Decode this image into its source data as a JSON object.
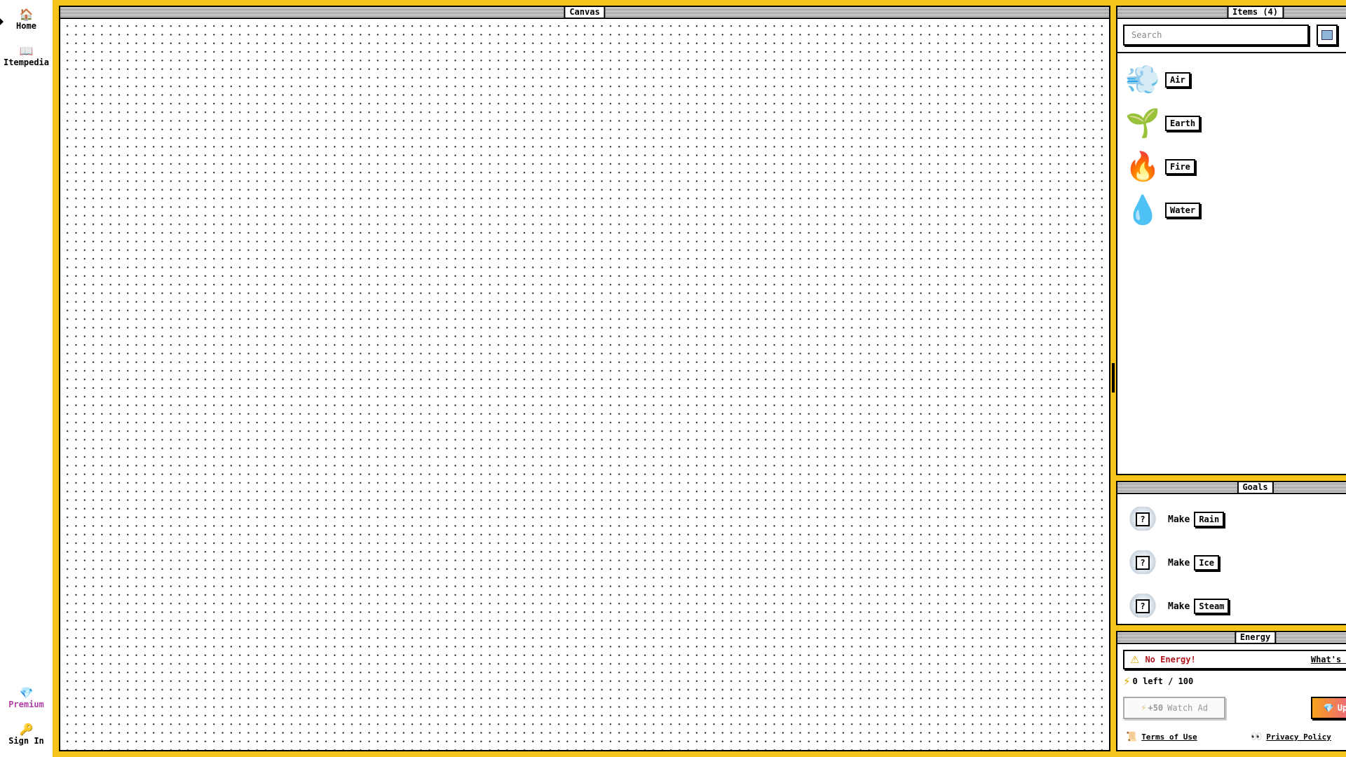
{
  "nav": {
    "home": {
      "label": "Home",
      "icon": "home-icon",
      "glyph": "🏠"
    },
    "itempedia": {
      "label": "Itempedia",
      "icon": "book-icon",
      "glyph": "📖"
    },
    "premium": {
      "label": "Premium",
      "icon": "gem-icon",
      "glyph": "💎",
      "color": "#b03fa7"
    },
    "signin": {
      "label": "Sign In",
      "icon": "key-icon",
      "glyph": "🔑"
    }
  },
  "canvas": {
    "title": "Canvas"
  },
  "items": {
    "title": "Items (4)",
    "search_placeholder": "Search",
    "list": [
      {
        "name": "Air",
        "emoji": "💨"
      },
      {
        "name": "Earth",
        "emoji": "🌱"
      },
      {
        "name": "Fire",
        "emoji": "🔥"
      },
      {
        "name": "Water",
        "emoji": "💧"
      }
    ]
  },
  "goals": {
    "title": "Goals",
    "make_label": "Make",
    "list": [
      {
        "target": "Rain"
      },
      {
        "target": "Ice"
      },
      {
        "target": "Steam"
      }
    ]
  },
  "energy": {
    "title": "Energy",
    "warning": "No Energy!",
    "whats_link": "What's Energy?",
    "count": "0 left / 100",
    "watch_ad_bonus": "+50",
    "watch_ad_label": "Watch Ad",
    "upgrade_label": "Upgrade",
    "terms_label": "Terms of Use",
    "privacy_label": "Privacy Policy"
  },
  "colors": {
    "frame": "#f6c31a",
    "premium": "#b03fa7",
    "warning": "#b0151d"
  }
}
